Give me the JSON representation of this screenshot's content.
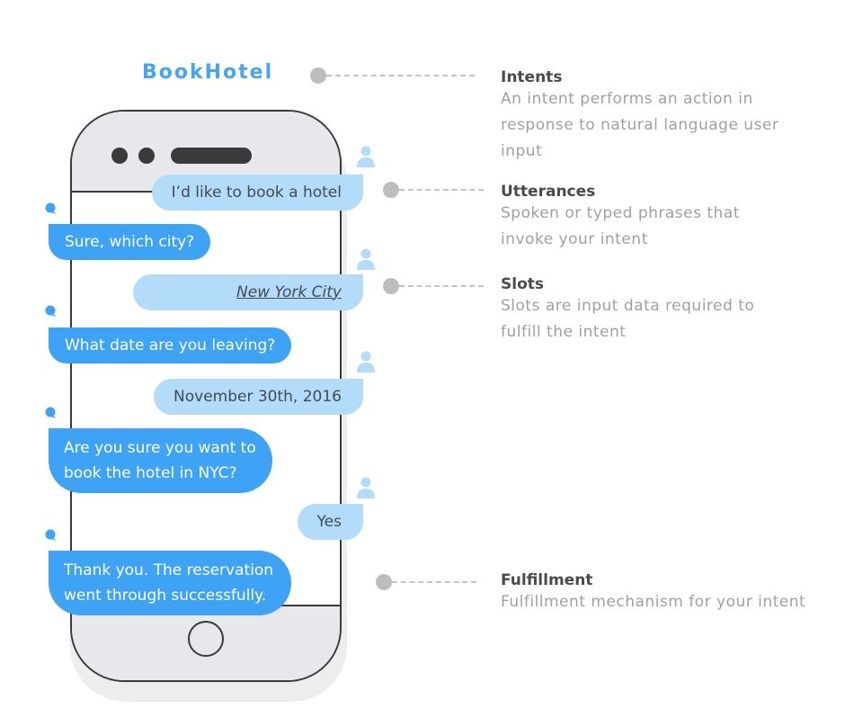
{
  "title": "BookHotel",
  "colors": {
    "accent": "#42a5f5",
    "bot_bubble": "#3fa3f5",
    "user_bubble": "#b3dcfb",
    "phone_frame": "#3a3a3a",
    "phone_panel": "#e6e8ec",
    "connector": "#bdbdbd"
  },
  "conversation": [
    {
      "speaker": "user",
      "icon": "user-icon",
      "text": "I’d like to book a hotel"
    },
    {
      "speaker": "bot",
      "icon": "chat-bubble-icon",
      "text": "Sure, which city?"
    },
    {
      "speaker": "user",
      "icon": "user-icon",
      "text": "New York City",
      "is_slot": true
    },
    {
      "speaker": "bot",
      "icon": "chat-bubble-icon",
      "text": "What date are you leaving?"
    },
    {
      "speaker": "user",
      "icon": "user-icon",
      "text": "November 30th, 2016"
    },
    {
      "speaker": "bot",
      "icon": "chat-bubble-icon",
      "lines": [
        "Are you sure you want to",
        "book the hotel in NYC?"
      ]
    },
    {
      "speaker": "user",
      "icon": "user-icon",
      "text": "Yes"
    },
    {
      "speaker": "bot",
      "icon": "chat-bubble-icon",
      "lines": [
        "Thank you. The reservation",
        "went through successfully."
      ]
    }
  ],
  "legend": [
    {
      "title": "Intents",
      "lines": [
        "An intent performs an action in",
        "response to natural language user",
        "input"
      ]
    },
    {
      "title": "Utterances",
      "lines": [
        "Spoken or typed phrases that",
        "invoke your intent"
      ]
    },
    {
      "title": "Slots",
      "lines": [
        "Slots are input data required to",
        "fulfill the intent"
      ]
    },
    {
      "title": "Fulfillment",
      "lines": [
        "Fulfillment mechanism for your intent"
      ]
    }
  ]
}
